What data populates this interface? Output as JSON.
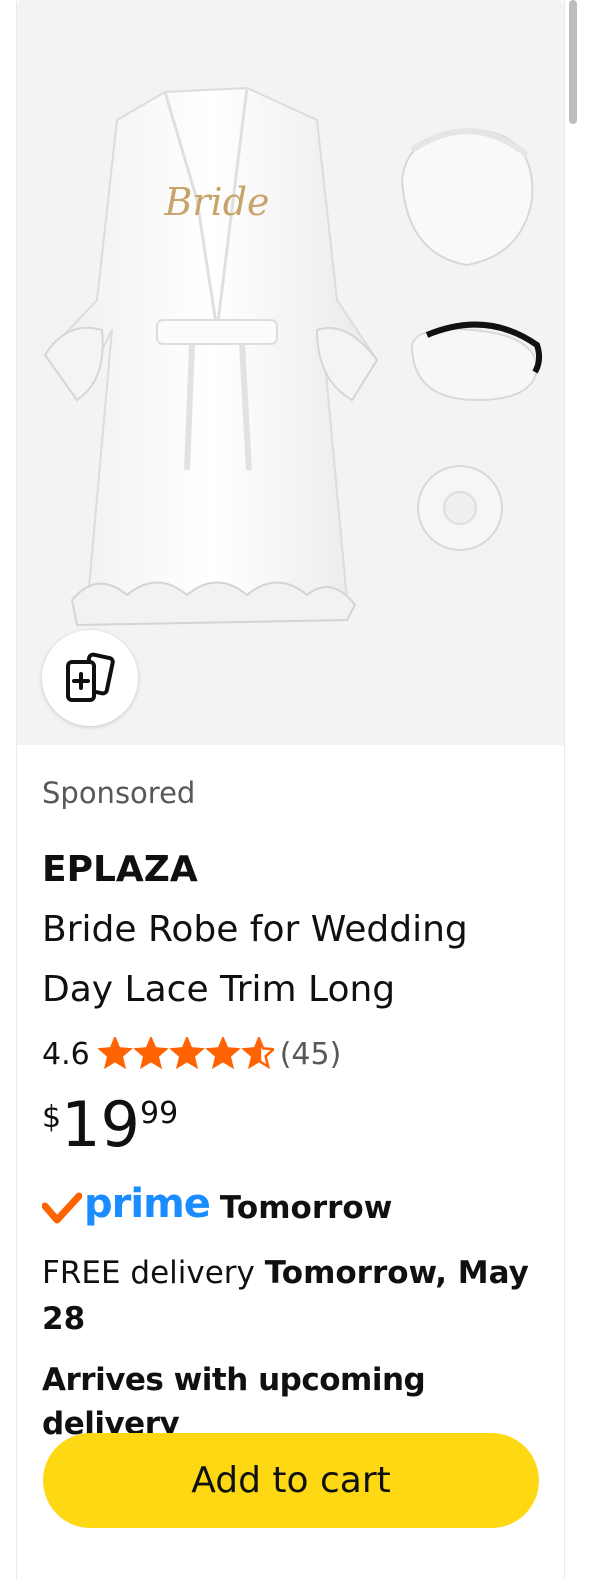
{
  "product": {
    "sponsored_label": "Sponsored",
    "brand": "EPLAZA",
    "title": "Bride Robe for Wedding Day Lace Trim Long Bridal...",
    "image_text": "Bride",
    "rating_value": "4.6",
    "rating_stars": 4.6,
    "review_count": "(45)",
    "price": {
      "symbol": "$",
      "whole": "19",
      "fraction": "99"
    },
    "prime": {
      "logo_text": "prime",
      "day": "Tomorrow"
    },
    "delivery": {
      "prefix": "FREE delivery ",
      "date": "Tomorrow, May 28"
    },
    "arrives_note": "Arrives with upcoming delivery",
    "add_to_cart_label": "Add to cart"
  },
  "icons": {
    "compare": "compare-add-icon",
    "star": "star-icon",
    "prime_check": "prime-check-icon"
  },
  "colors": {
    "star": "#ff6200",
    "prime_blue": "#1a8cff",
    "prime_check": "#ff6200",
    "cart_button": "#ffd814"
  }
}
